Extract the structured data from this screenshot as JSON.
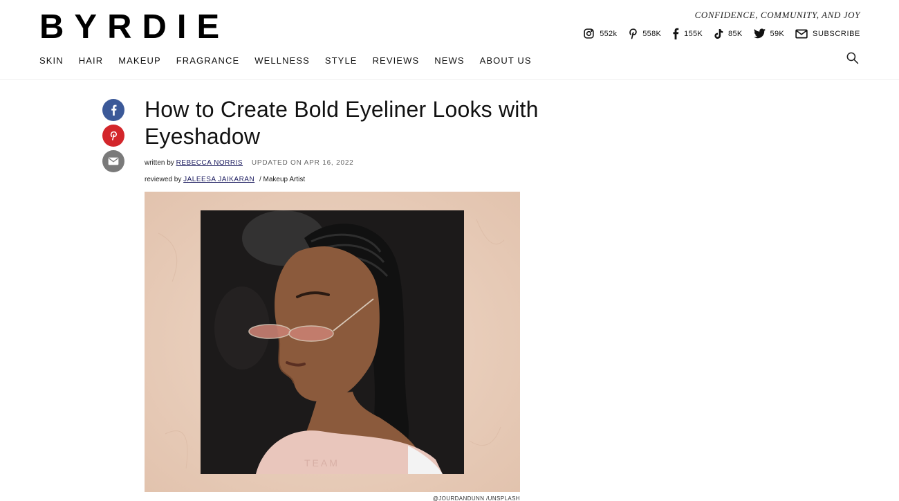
{
  "header": {
    "logo": "BYRDIE",
    "tagline": "CONFIDENCE, COMMUNITY, AND JOY",
    "social": [
      {
        "icon": "instagram-icon",
        "count": "552k"
      },
      {
        "icon": "pinterest-icon",
        "count": "558K"
      },
      {
        "icon": "facebook-icon",
        "count": "155K"
      },
      {
        "icon": "tiktok-icon",
        "count": "85K"
      },
      {
        "icon": "twitter-icon",
        "count": "59K"
      }
    ],
    "subscribe_label": "SUBSCRIBE",
    "nav": [
      "SKIN",
      "HAIR",
      "MAKEUP",
      "FRAGRANCE",
      "WELLNESS",
      "STYLE",
      "REVIEWS",
      "NEWS",
      "ABOUT US"
    ]
  },
  "share": [
    {
      "icon": "facebook-icon",
      "color": "#3b5998"
    },
    {
      "icon": "pinterest-icon",
      "color": "#d3262b"
    },
    {
      "icon": "email-icon",
      "color": "#7a7a7a"
    }
  ],
  "article": {
    "title": "How to Create Bold Eyeliner Looks with Eyeshadow",
    "written_by_prefix": "written by",
    "author": "REBECCA NORRIS",
    "updated": "UPDATED ON APR 16, 2022",
    "reviewed_by_prefix": "reviewed by",
    "reviewer": "JALEESA JAIKARAN",
    "reviewer_role": "/ Makeup Artist",
    "image_credit": "@JOURDANDUNN /UNSPLASH"
  },
  "colors": {
    "hero_background": "#ead1bf",
    "photo_background": "#1c1a1a",
    "link": "#1a1a5e"
  }
}
